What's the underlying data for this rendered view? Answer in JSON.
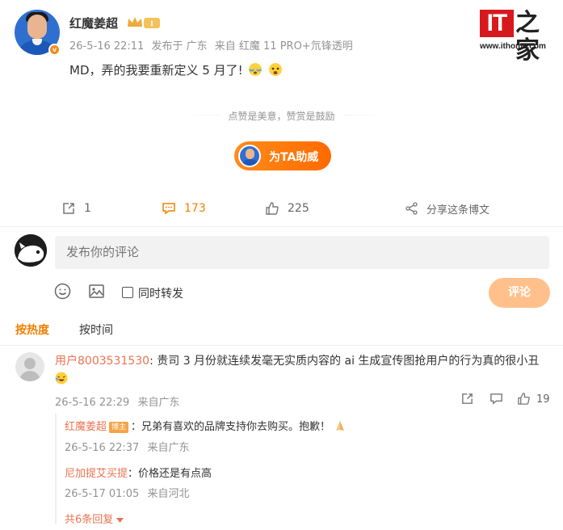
{
  "post": {
    "username": "红魔姜超",
    "level_badge": "I",
    "date": "26-5-16 22:11",
    "location": "发布于 广东",
    "source": "来自 红魔 11 PRO+氘锋透明",
    "text": "MD，弄的我要重新定义 5 月了!"
  },
  "watermark": {
    "brand_it": "IT",
    "brand_zh": "之家",
    "url": "www.ithome.com"
  },
  "reward": {
    "caption": "点赞是美意，赞赏是鼓励",
    "cheer_button": "为TA助威"
  },
  "actions": {
    "repost_count": "1",
    "comment_count": "173",
    "like_count": "225",
    "share_label": "分享这条博文"
  },
  "composer": {
    "placeholder": "发布你的评论",
    "forward_label": "同时转发",
    "submit_label": "评论"
  },
  "sort": {
    "hot": "按热度",
    "time": "按时间"
  },
  "comment": {
    "username": "用户8003531530",
    "text": ": 贵司 3 月份就连续发毫无实质内容的 ai 生成宣传图抢用户的行为真的很小丑",
    "date": "26-5-16 22:29",
    "location": "来自广东",
    "like_count": "19",
    "replies": [
      {
        "username": "红魔姜超",
        "badge": "博主",
        "text": "：兄弟有喜欢的品牌支持你去购买。抱歉！",
        "date": "26-5-16 22:37",
        "location": "来自广东"
      },
      {
        "username": "尼加提艾买提",
        "text": "：价格还是有点高",
        "date": "26-5-17 01:05",
        "location": "来自河北"
      }
    ],
    "more_replies": "共6条回复"
  },
  "colors": {
    "accent": "#f18000",
    "username_link": "#eb7350",
    "watermark_red": "#d7191e"
  }
}
